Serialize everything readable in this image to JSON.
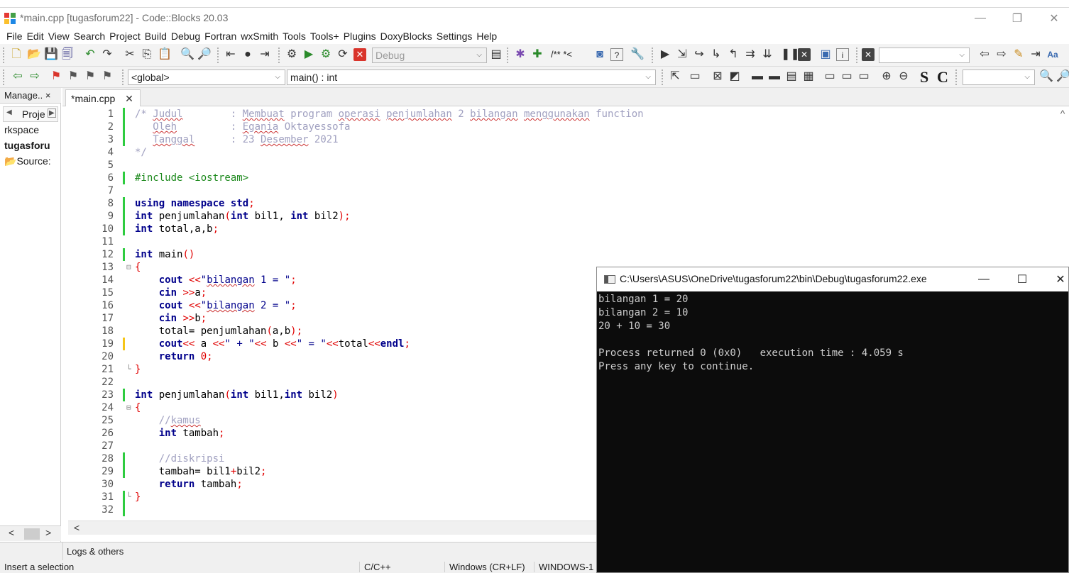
{
  "window": {
    "title": "*main.cpp [tugasforum22] - Code::Blocks 20.03",
    "minimize": "—",
    "restore": "❐",
    "close": "✕"
  },
  "menu": [
    "File",
    "Edit",
    "View",
    "Search",
    "Project",
    "Build",
    "Debug",
    "Fortran",
    "wxSmith",
    "Tools",
    "Tools+",
    "Plugins",
    "DoxyBlocks",
    "Settings",
    "Help"
  ],
  "toolbar": {
    "build_target": "Debug",
    "doxy_comment": "/** *<",
    "search_value": "",
    "scope": "<global>",
    "function": "main() : int",
    "style_s": "S",
    "style_c": "C"
  },
  "management": {
    "tab": "Manage.. ×",
    "projects_tab": "Proje",
    "tree": [
      "rkspace",
      "tugasforu",
      "Source:"
    ]
  },
  "editor": {
    "tab_label": "*main.cpp",
    "tab_close": "✕",
    "lines": [
      {
        "n": "1",
        "text": "/* Judul        : Membuat program operasi penjumlahan 2 bilangan menggunakan function"
      },
      {
        "n": "2",
        "text": "   Oleh         : Egania Oktayessofa"
      },
      {
        "n": "3",
        "text": "   Tanggal      : 23 Desember 2021"
      },
      {
        "n": "4",
        "text": "*/"
      },
      {
        "n": "5",
        "text": ""
      },
      {
        "n": "6",
        "text": "#include <iostream>"
      },
      {
        "n": "7",
        "text": ""
      },
      {
        "n": "8",
        "text": "using namespace std;"
      },
      {
        "n": "9",
        "text": "int penjumlahan(int bil1, int bil2);"
      },
      {
        "n": "10",
        "text": "int total,a,b;"
      },
      {
        "n": "11",
        "text": ""
      },
      {
        "n": "12",
        "text": "int main()"
      },
      {
        "n": "13",
        "text": "{"
      },
      {
        "n": "14",
        "text": "    cout <<\"bilangan 1 = \";"
      },
      {
        "n": "15",
        "text": "    cin >>a;"
      },
      {
        "n": "16",
        "text": "    cout <<\"bilangan 2 = \";"
      },
      {
        "n": "17",
        "text": "    cin >>b;"
      },
      {
        "n": "18",
        "text": "    total= penjumlahan(a,b);"
      },
      {
        "n": "19",
        "text": "    cout<< a <<\" + \"<< b <<\" = \"<<total<<endl;"
      },
      {
        "n": "20",
        "text": "    return 0;"
      },
      {
        "n": "21",
        "text": "}"
      },
      {
        "n": "22",
        "text": ""
      },
      {
        "n": "23",
        "text": "int penjumlahan(int bil1,int bil2)"
      },
      {
        "n": "24",
        "text": "{"
      },
      {
        "n": "25",
        "text": "    //kamus"
      },
      {
        "n": "26",
        "text": "    int tambah;"
      },
      {
        "n": "27",
        "text": ""
      },
      {
        "n": "28",
        "text": "    //diskripsi"
      },
      {
        "n": "29",
        "text": "    tambah= bil1+bil2;"
      },
      {
        "n": "30",
        "text": "    return tambah;"
      },
      {
        "n": "31",
        "text": "}"
      },
      {
        "n": "32",
        "text": ""
      }
    ]
  },
  "logs": {
    "tab": "Logs & others"
  },
  "status": {
    "message": "Insert a selection",
    "language": "C/C++",
    "line_endings": "Windows (CR+LF)",
    "encoding": "WINDOWS-1"
  },
  "console": {
    "title": "C:\\Users\\ASUS\\OneDrive\\tugasforum22\\bin\\Debug\\tugasforum22.exe",
    "minimize": "—",
    "maximize": "☐",
    "close": "✕",
    "lines": [
      "bilangan 1 = 20",
      "bilangan 2 = 10",
      "20 + 10 = 30",
      "",
      "Process returned 0 (0x0)   execution time : 4.059 s",
      "Press any key to continue."
    ]
  },
  "colors": {
    "keyword": "#00008b",
    "comment": "#a0a0c0",
    "preprocessor": "#1e8a1e",
    "number": "#e00000",
    "saved_change": "#2ecc40",
    "unsaved_change": "#f5c518",
    "console_bg": "#0c0c0c"
  }
}
